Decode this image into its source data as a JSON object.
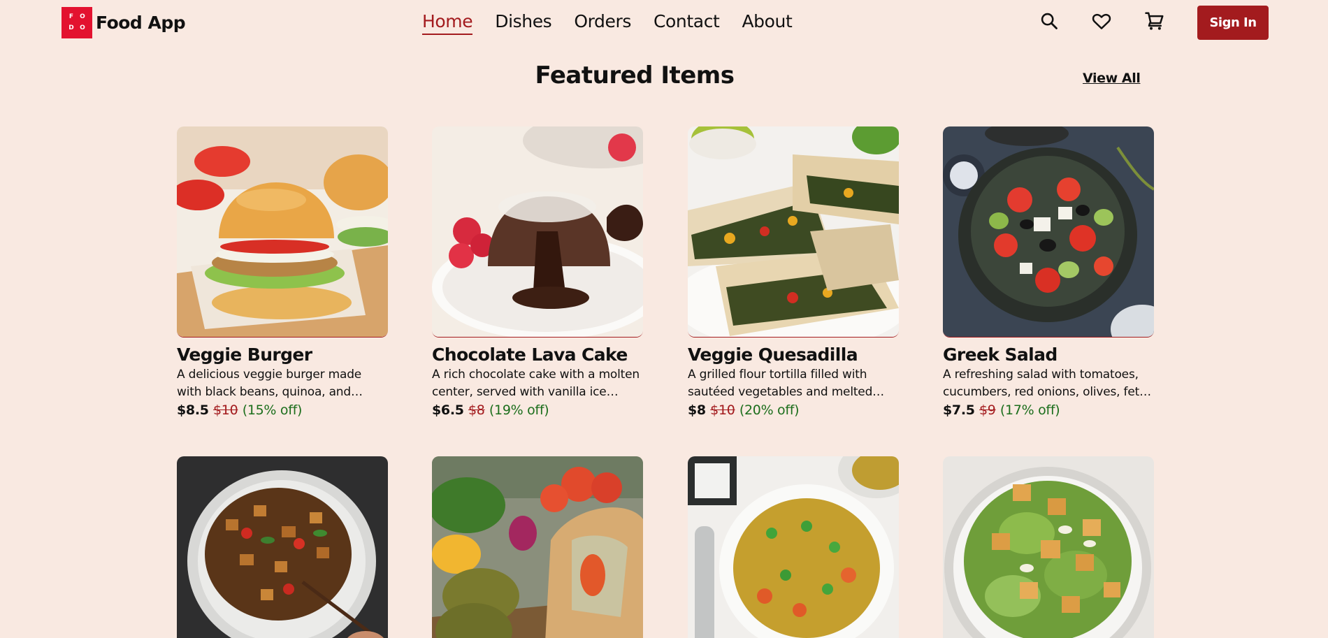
{
  "brand": {
    "logo_letters": [
      "F",
      "O",
      "D",
      "O"
    ],
    "name": "Food App",
    "color": "#e3122f"
  },
  "nav": {
    "items": [
      {
        "label": "Home",
        "active": true
      },
      {
        "label": "Dishes",
        "active": false
      },
      {
        "label": "Orders",
        "active": false
      },
      {
        "label": "Contact",
        "active": false
      },
      {
        "label": "About",
        "active": false
      }
    ],
    "active_color": "#a31b1e"
  },
  "header_icons": [
    "search-icon",
    "heart-icon",
    "cart-icon"
  ],
  "signin_label": "Sign In",
  "featured": {
    "title": "Featured Items",
    "view_all": "View All",
    "items": [
      {
        "name": "Veggie Burger",
        "description": "A delicious veggie burger made with black beans, quinoa, and spices, topped with fresh vegetables.",
        "price": "$8.5",
        "old_price": "$10",
        "discount": "(15% off)"
      },
      {
        "name": "Chocolate Lava Cake",
        "description": "A rich chocolate cake with a molten center, served with vanilla ice cream.",
        "price": "$6.5",
        "old_price": "$8",
        "discount": "(19% off)"
      },
      {
        "name": "Veggie Quesadilla",
        "description": "A grilled flour tortilla filled with sautéed vegetables and melted cheese, served with salsa.",
        "price": "$8",
        "old_price": "$10",
        "discount": "(20% off)"
      },
      {
        "name": "Greek Salad",
        "description": "A refreshing salad with tomatoes, cucumbers, red onions, olives, feta cheese and olive oil.",
        "price": "$7.5",
        "old_price": "$9",
        "discount": "(17% off)"
      },
      {
        "name": "",
        "description": "",
        "price": "",
        "old_price": "",
        "discount": ""
      },
      {
        "name": "",
        "description": "",
        "price": "",
        "old_price": "",
        "discount": ""
      },
      {
        "name": "",
        "description": "",
        "price": "",
        "old_price": "",
        "discount": ""
      },
      {
        "name": "",
        "description": "",
        "price": "",
        "old_price": "",
        "discount": ""
      }
    ]
  },
  "colors": {
    "background": "#f9e9e1",
    "accent": "#a31b1e",
    "discount": "#1c6e1c"
  }
}
